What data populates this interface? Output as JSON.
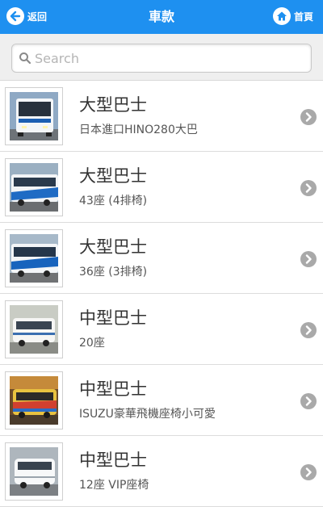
{
  "header": {
    "title": "車款",
    "back_label": "返回",
    "home_label": "首頁",
    "bar_color": "#1e90f0"
  },
  "search": {
    "placeholder": "Search",
    "value": ""
  },
  "vehicles": [
    {
      "name": "大型巴士",
      "desc": "日本進口HINO280大巴",
      "thumb_icon": "coach-front-icon"
    },
    {
      "name": "大型巴士",
      "desc": "43座 (4排椅)",
      "thumb_icon": "coach-side-icon"
    },
    {
      "name": "大型巴士",
      "desc": "36座 (3排椅)",
      "thumb_icon": "coach-side-icon"
    },
    {
      "name": "中型巴士",
      "desc": "20座",
      "thumb_icon": "minibus-icon"
    },
    {
      "name": "中型巴士",
      "desc": "ISUZU豪華飛機座椅小可愛",
      "thumb_icon": "minibus-colorful-icon"
    },
    {
      "name": "中型巴士",
      "desc": "12座 VIP座椅",
      "thumb_icon": "minibus-white-icon"
    }
  ]
}
